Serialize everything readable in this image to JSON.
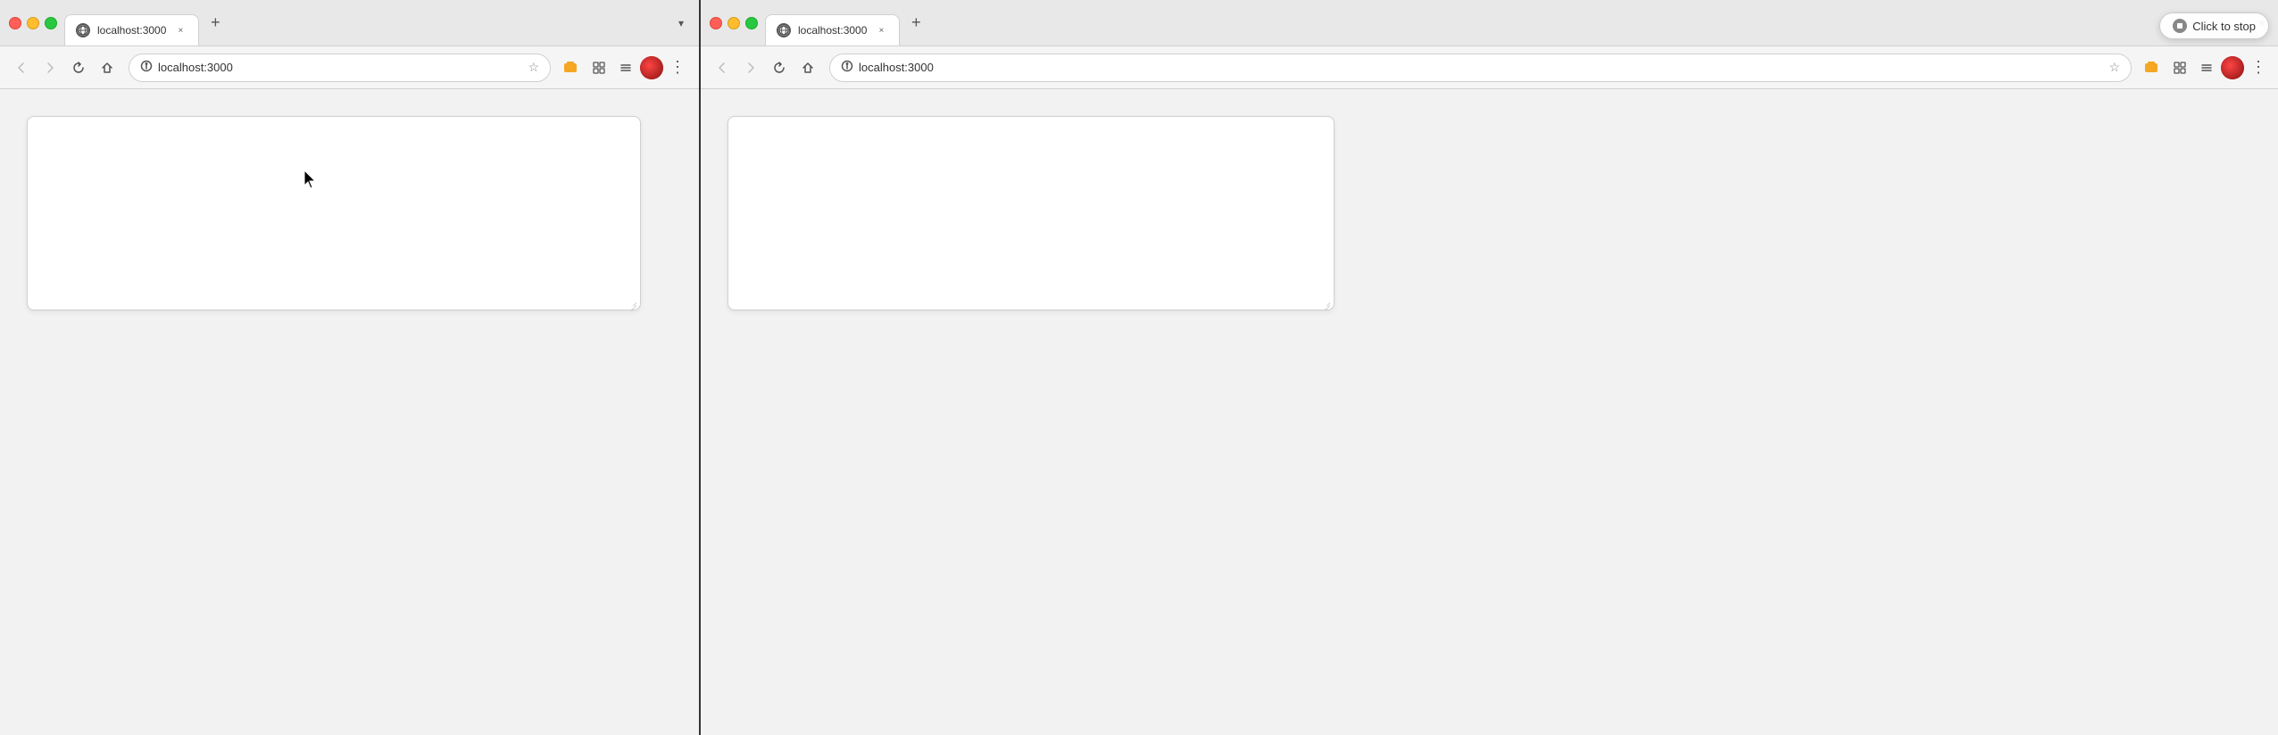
{
  "left_browser": {
    "tab": {
      "favicon_symbol": "🌐",
      "title": "localhost:3000",
      "close_label": "×"
    },
    "new_tab_label": "+",
    "nav": {
      "back_label": "‹",
      "forward_label": "›",
      "reload_label": "↻",
      "home_label": "⌂",
      "url": "localhost:3000",
      "star_label": "☆",
      "extension1_label": "⬛",
      "extension2_label": "🧩",
      "extension3_label": "≡",
      "menu_label": "⋮"
    },
    "textarea": {
      "placeholder": ""
    }
  },
  "right_browser": {
    "tab": {
      "favicon_symbol": "🌐",
      "title": "localhost:3000",
      "close_label": "×"
    },
    "new_tab_label": "+",
    "nav": {
      "back_label": "‹",
      "forward_label": "›",
      "reload_label": "↻",
      "home_label": "⌂",
      "url": "localhost:3000",
      "star_label": "☆",
      "extension1_label": "⬛",
      "extension2_label": "🧩",
      "extension3_label": "≡",
      "menu_label": "⋮"
    },
    "textarea": {
      "placeholder": ""
    }
  },
  "overlay": {
    "click_to_stop_label": "Click to stop"
  }
}
